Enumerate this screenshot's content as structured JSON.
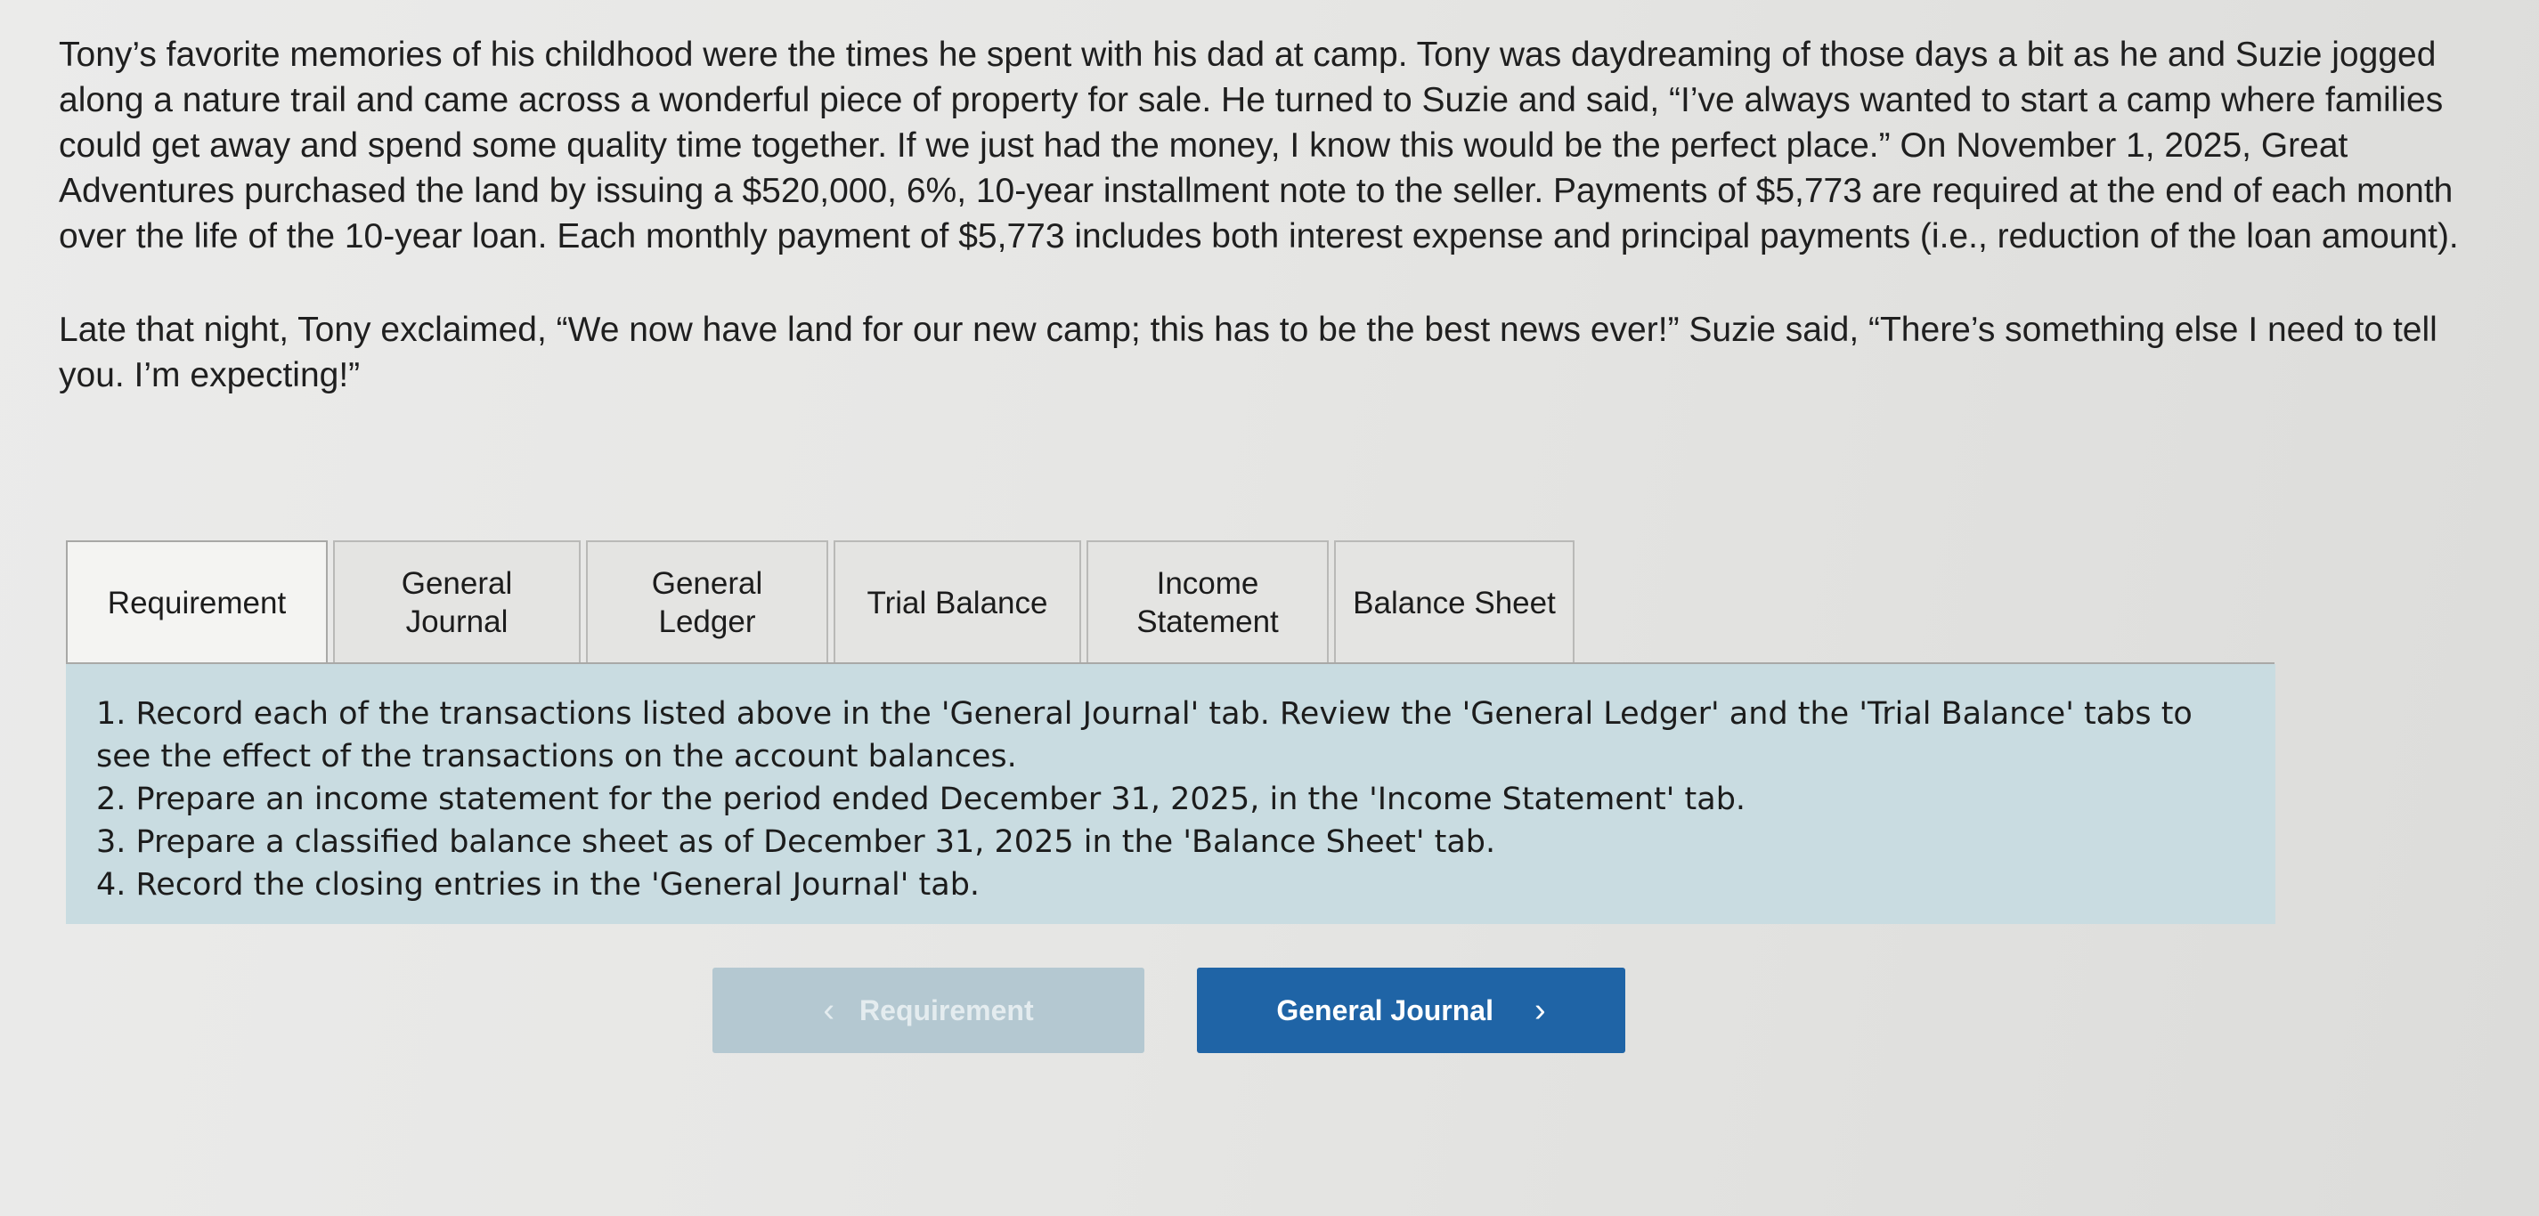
{
  "problem": {
    "paragraph_1": "Tony’s favorite memories of his childhood were the times he spent with his dad at camp. Tony was daydreaming of those days a bit as he and Suzie jogged along a nature trail and came across a wonderful piece of property for sale. He turned to Suzie and said, “I’ve always wanted to start a camp where families could get away and spend some quality time together. If we just had the money, I know this would be the perfect place.” On November 1, 2025, Great Adventures purchased the land by issuing a $520,000, 6%, 10-year installment note to the seller. Payments of $5,773 are required at the end of each month over the life of the 10-year loan. Each monthly payment of $5,773 includes both interest expense and principal payments (i.e., reduction of the loan amount).",
    "paragraph_2": "Late that night, Tony exclaimed, “We now have land for our new camp; this has to be the best news ever!” Suzie said, “There’s something else I need to tell you. I’m expecting!”"
  },
  "tabs": [
    {
      "label": "Requirement",
      "active": true
    },
    {
      "label": "General\nJournal",
      "active": false
    },
    {
      "label": "General\nLedger",
      "active": false
    },
    {
      "label": "Trial Balance",
      "active": false
    },
    {
      "label": "Income\nStatement",
      "active": false
    },
    {
      "label": "Balance Sheet",
      "active": false
    }
  ],
  "requirements": [
    "1. Record each of the transactions listed above in the 'General Journal' tab. Review the 'General Ledger' and the 'Trial Balance' tabs to see the effect of the transactions on the account balances.",
    "2. Prepare an income statement for the period ended December 31, 2025, in the 'Income Statement' tab.",
    "3. Prepare a classified balance sheet as of December 31, 2025 in the 'Balance Sheet' tab.",
    "4. Record the closing entries in the 'General Journal' tab."
  ],
  "navigation": {
    "prev_label": "Requirement",
    "next_label": "General Journal",
    "prev_enabled": false
  },
  "colors": {
    "panel_background": "#c9dce1",
    "next_button": "#1f64a6",
    "prev_button_disabled": "#b4c8d1"
  },
  "icons": {
    "prev": "chevron-left-icon",
    "next": "chevron-right-icon"
  }
}
